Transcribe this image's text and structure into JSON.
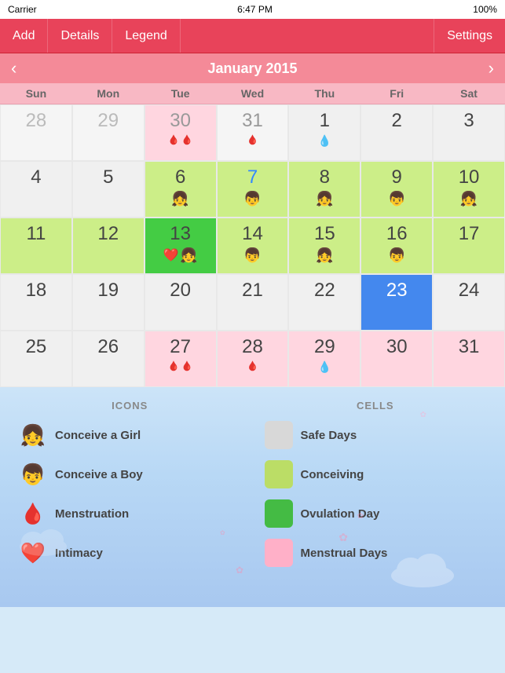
{
  "statusBar": {
    "carrier": "Carrier",
    "time": "6:47 PM",
    "battery": "100%"
  },
  "toolbar": {
    "add": "Add",
    "details": "Details",
    "legend": "Legend",
    "settings": "Settings"
  },
  "monthHeader": {
    "title": "January 2015",
    "prevArrow": "‹",
    "nextArrow": "›"
  },
  "dayHeaders": [
    "Sun",
    "Mon",
    "Tue",
    "Wed",
    "Thu",
    "Fri",
    "Sat"
  ],
  "weeks": [
    [
      {
        "day": "28",
        "type": "outside",
        "icons": []
      },
      {
        "day": "29",
        "type": "outside",
        "icons": []
      },
      {
        "day": "30",
        "type": "menstrual",
        "icons": [
          "🩸🩸"
        ],
        "numStyle": "darkgray"
      },
      {
        "day": "31",
        "type": "outside",
        "icons": [
          "🩸"
        ],
        "numStyle": "darkgray"
      },
      {
        "day": "1",
        "type": "safe",
        "icons": [
          "💧"
        ]
      },
      {
        "day": "2",
        "type": "safe",
        "icons": []
      },
      {
        "day": "3",
        "type": "safe",
        "icons": []
      }
    ],
    [
      {
        "day": "4",
        "type": "safe",
        "icons": []
      },
      {
        "day": "5",
        "type": "safe",
        "icons": []
      },
      {
        "day": "6",
        "type": "conceiving",
        "icons": [
          "👶🏻"
        ]
      },
      {
        "day": "7",
        "type": "conceiving",
        "icons": [
          "👶🏻"
        ],
        "numStyle": "blue"
      },
      {
        "day": "8",
        "type": "conceiving",
        "icons": [
          "👶🏻"
        ]
      },
      {
        "day": "9",
        "type": "conceiving",
        "icons": [
          "👶🏻"
        ]
      },
      {
        "day": "10",
        "type": "conceiving",
        "icons": [
          "👶🏻"
        ]
      }
    ],
    [
      {
        "day": "11",
        "type": "conceiving",
        "icons": []
      },
      {
        "day": "12",
        "type": "conceiving",
        "icons": []
      },
      {
        "day": "13",
        "type": "ovulation",
        "icons": [
          "❤️",
          "👶🏻"
        ]
      },
      {
        "day": "14",
        "type": "conceiving",
        "icons": [
          "👶🏻"
        ]
      },
      {
        "day": "15",
        "type": "conceiving",
        "icons": [
          "👶🏻"
        ]
      },
      {
        "day": "16",
        "type": "conceiving",
        "icons": [
          "👶🏻"
        ]
      },
      {
        "day": "17",
        "type": "conceiving",
        "icons": []
      }
    ],
    [
      {
        "day": "18",
        "type": "safe",
        "icons": []
      },
      {
        "day": "19",
        "type": "safe",
        "icons": []
      },
      {
        "day": "20",
        "type": "safe",
        "icons": []
      },
      {
        "day": "21",
        "type": "safe",
        "icons": []
      },
      {
        "day": "22",
        "type": "safe",
        "icons": []
      },
      {
        "day": "23",
        "type": "today",
        "icons": [],
        "numStyle": "white"
      },
      {
        "day": "24",
        "type": "safe",
        "icons": []
      }
    ],
    [
      {
        "day": "25",
        "type": "safe",
        "icons": []
      },
      {
        "day": "26",
        "type": "safe",
        "icons": []
      },
      {
        "day": "27",
        "type": "menstrual-future",
        "icons": [
          "🩸🩸"
        ]
      },
      {
        "day": "28",
        "type": "menstrual-future",
        "icons": [
          "🩸"
        ]
      },
      {
        "day": "29",
        "type": "menstrual-future",
        "icons": [
          "💧"
        ]
      },
      {
        "day": "30",
        "type": "menstrual-future",
        "icons": []
      },
      {
        "day": "31",
        "type": "menstrual-future",
        "icons": []
      }
    ]
  ],
  "legend": {
    "iconsTitle": "ICONS",
    "cellsTitle": "CELLS",
    "icons": [
      {
        "icon": "girl",
        "label": "Conceive a Girl"
      },
      {
        "icon": "boy",
        "label": "Conceive a Boy"
      },
      {
        "icon": "blood",
        "label": "Menstruation"
      },
      {
        "icon": "heart",
        "label": "Intimacy"
      }
    ],
    "cells": [
      {
        "swatch": "safe",
        "label": "Safe Days"
      },
      {
        "swatch": "conceiving",
        "label": "Conceiving"
      },
      {
        "swatch": "ovulation",
        "label": "Ovulation Day"
      },
      {
        "swatch": "menstrual",
        "label": "Menstrual Days"
      }
    ]
  }
}
